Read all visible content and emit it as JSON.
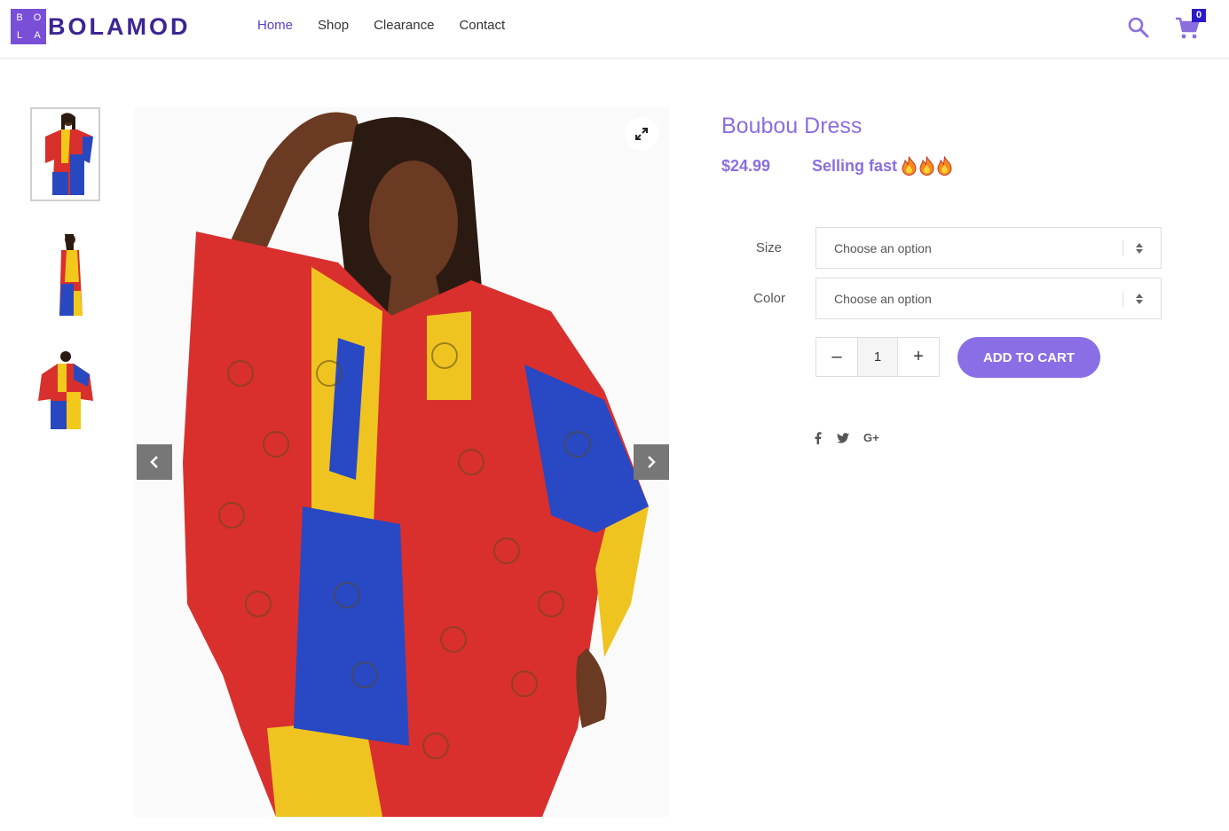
{
  "brand": {
    "logo_letters": [
      "B",
      "O",
      "L",
      "A"
    ],
    "name": "BOLAMOD",
    "colors": {
      "primary": "#7a4fd8",
      "dark": "#3c2594",
      "accent": "#8a6ee0"
    }
  },
  "nav": {
    "items": [
      {
        "label": "Home",
        "active": true
      },
      {
        "label": "Shop",
        "active": false
      },
      {
        "label": "Clearance",
        "active": false
      },
      {
        "label": "Contact",
        "active": false
      }
    ]
  },
  "header": {
    "search_icon": "search-icon",
    "cart_icon": "cart-icon",
    "cart_count": "0"
  },
  "gallery": {
    "thumbnails": [
      "front-view",
      "side-view",
      "back-view"
    ],
    "zoom_icon": "expand-icon",
    "prev_icon": "chevron-left-icon",
    "next_icon": "chevron-right-icon"
  },
  "product": {
    "title": "Boubou Dress",
    "price": "$24.99",
    "badge": "Selling fast",
    "badge_icons": [
      "fire-icon",
      "fire-icon",
      "fire-icon"
    ],
    "options": [
      {
        "label": "Size",
        "placeholder": "Choose an option"
      },
      {
        "label": "Color",
        "placeholder": "Choose an option"
      }
    ],
    "quantity": {
      "minus": "–",
      "value": "1",
      "plus": "+"
    },
    "add_to_cart": "ADD TO CART"
  },
  "social": {
    "items": [
      {
        "label": "f",
        "icon": "facebook-icon"
      },
      {
        "label": "twitter",
        "icon": "twitter-icon"
      },
      {
        "label": "G+",
        "icon": "google-plus-icon"
      }
    ]
  }
}
